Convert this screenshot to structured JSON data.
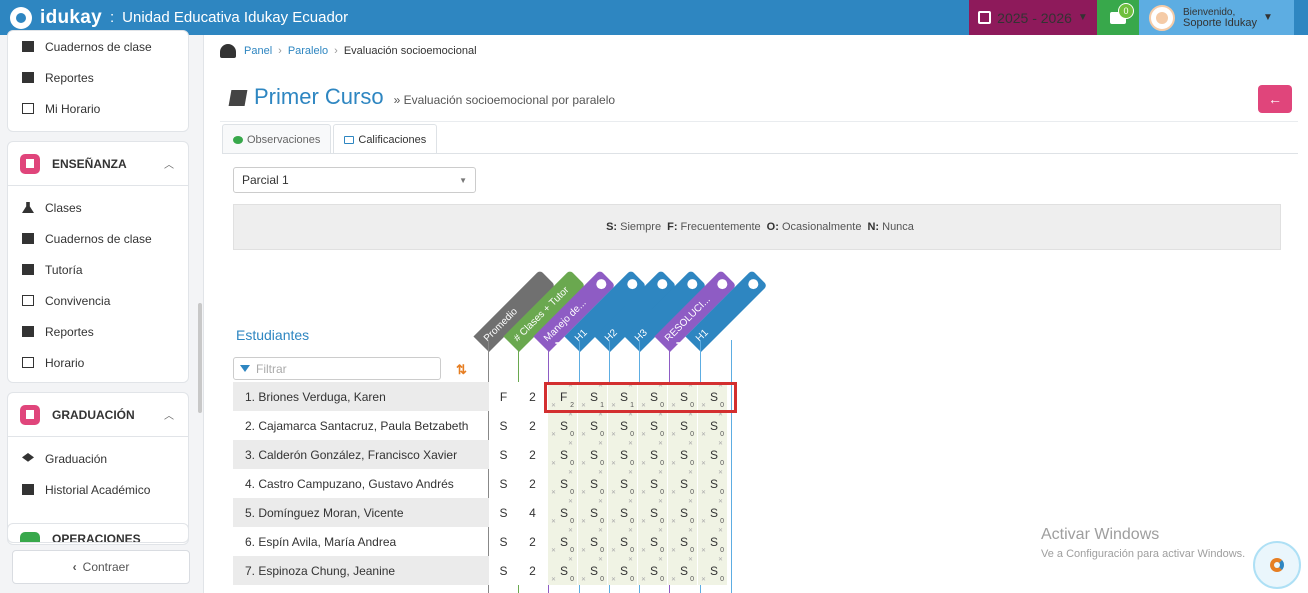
{
  "topbar": {
    "brand": "idukay",
    "separator": ":",
    "school": "Unidad Educativa Idukay Ecuador",
    "year": "2025 - 2026",
    "messages_count": "0",
    "user_greeting": "Bienvenido,",
    "user_name": "Soporte Idukay",
    "colors": {
      "bar": "#2e86c1",
      "year": "#8e1a5b",
      "messages": "#38a84b",
      "user": "#5dade2"
    }
  },
  "sidebar": {
    "top_items": [
      {
        "label": "Cuadernos de clase",
        "icon": "notebook-icon"
      },
      {
        "label": "Reportes",
        "icon": "bar-chart-icon"
      },
      {
        "label": "Mi Horario",
        "icon": "calendar-icon"
      }
    ],
    "sections": [
      {
        "title": "ENSEÑANZA",
        "icon_color": "#e0457b",
        "items": [
          {
            "label": "Clases",
            "icon": "flask-icon"
          },
          {
            "label": "Cuadernos de clase",
            "icon": "notebook-icon"
          },
          {
            "label": "Tutoría",
            "icon": "thumbs-up-icon"
          },
          {
            "label": "Convivencia",
            "icon": "list-icon"
          },
          {
            "label": "Reportes",
            "icon": "bar-chart-icon"
          },
          {
            "label": "Horario",
            "icon": "calendar-icon"
          }
        ]
      },
      {
        "title": "GRADUACIÓN",
        "icon_color": "#e0457b",
        "items": [
          {
            "label": "Graduación",
            "icon": "graduation-cap-icon"
          },
          {
            "label": "Historial Académico",
            "icon": "folder-icon"
          }
        ]
      },
      {
        "title": "OPERACIONES",
        "icon_color": "#38a84b",
        "items": []
      }
    ],
    "collapse_label": "Contraer"
  },
  "breadcrumb": {
    "home": "Panel",
    "parent": "Paralelo",
    "current": "Evaluación socioemocional"
  },
  "page": {
    "title": "Primer Curso",
    "subtitle": "» Evaluación socioemocional por paralelo"
  },
  "tabs": [
    {
      "label": "Observaciones",
      "active": false
    },
    {
      "label": "Calificaciones",
      "active": true
    }
  ],
  "period_select": {
    "value": "Parcial 1"
  },
  "legend": [
    {
      "key": "S:",
      "text": "Siempre"
    },
    {
      "key": "F:",
      "text": "Frecuentemente"
    },
    {
      "key": "O:",
      "text": "Ocasionalmente"
    },
    {
      "key": "N:",
      "text": "Nunca"
    }
  ],
  "students_label": "Estudiantes",
  "filter_placeholder": "Filtrar",
  "columns": [
    {
      "label": "Promedio",
      "color": "#707070"
    },
    {
      "label": "# Clases + Tutor",
      "color": "#6aa84f"
    },
    {
      "label": "Manejo de...",
      "color": "#8e5cc4"
    },
    {
      "label": "H1",
      "color": "#2e86c1"
    },
    {
      "label": "H2",
      "color": "#2e86c1"
    },
    {
      "label": "H3",
      "color": "#2e86c1"
    },
    {
      "label": "RESOLUCI...",
      "color": "#8e5cc4"
    },
    {
      "label": "H1",
      "color": "#2e86c1"
    }
  ],
  "rows": [
    {
      "name": "1. Briones Verduga, Karen",
      "promedio": "F",
      "clases": "2",
      "grades": [
        [
          "F",
          "2"
        ],
        [
          "S",
          "1"
        ],
        [
          "S",
          "1"
        ],
        [
          "S",
          "0"
        ],
        [
          "S",
          "0"
        ],
        [
          "S",
          "0"
        ]
      ]
    },
    {
      "name": "2. Cajamarca Santacruz, Paula Betzabeth",
      "promedio": "S",
      "clases": "2",
      "grades": [
        [
          "S",
          "0"
        ],
        [
          "S",
          "0"
        ],
        [
          "S",
          "0"
        ],
        [
          "S",
          "0"
        ],
        [
          "S",
          "0"
        ],
        [
          "S",
          "0"
        ]
      ]
    },
    {
      "name": "3. Calderón González, Francisco Xavier",
      "promedio": "S",
      "clases": "2",
      "grades": [
        [
          "S",
          "0"
        ],
        [
          "S",
          "0"
        ],
        [
          "S",
          "0"
        ],
        [
          "S",
          "0"
        ],
        [
          "S",
          "0"
        ],
        [
          "S",
          "0"
        ]
      ]
    },
    {
      "name": "4. Castro Campuzano, Gustavo Andrés",
      "promedio": "S",
      "clases": "2",
      "grades": [
        [
          "S",
          "0"
        ],
        [
          "S",
          "0"
        ],
        [
          "S",
          "0"
        ],
        [
          "S",
          "0"
        ],
        [
          "S",
          "0"
        ],
        [
          "S",
          "0"
        ]
      ]
    },
    {
      "name": "5. Domínguez Moran, Vicente",
      "promedio": "S",
      "clases": "4",
      "grades": [
        [
          "S",
          "0"
        ],
        [
          "S",
          "0"
        ],
        [
          "S",
          "0"
        ],
        [
          "S",
          "0"
        ],
        [
          "S",
          "0"
        ],
        [
          "S",
          "0"
        ]
      ]
    },
    {
      "name": "6. Espín Avila, María Andrea",
      "promedio": "S",
      "clases": "2",
      "grades": [
        [
          "S",
          "0"
        ],
        [
          "S",
          "0"
        ],
        [
          "S",
          "0"
        ],
        [
          "S",
          "0"
        ],
        [
          "S",
          "0"
        ],
        [
          "S",
          "0"
        ]
      ]
    },
    {
      "name": "7. Espinoza Chung, Jeanine",
      "promedio": "S",
      "clases": "2",
      "grades": [
        [
          "S",
          "0"
        ],
        [
          "S",
          "0"
        ],
        [
          "S",
          "0"
        ],
        [
          "S",
          "0"
        ],
        [
          "S",
          "0"
        ],
        [
          "S",
          "0"
        ]
      ]
    }
  ],
  "watermark": {
    "title": "Activar Windows",
    "subtitle": "Ve a Configuración para activar Windows."
  }
}
